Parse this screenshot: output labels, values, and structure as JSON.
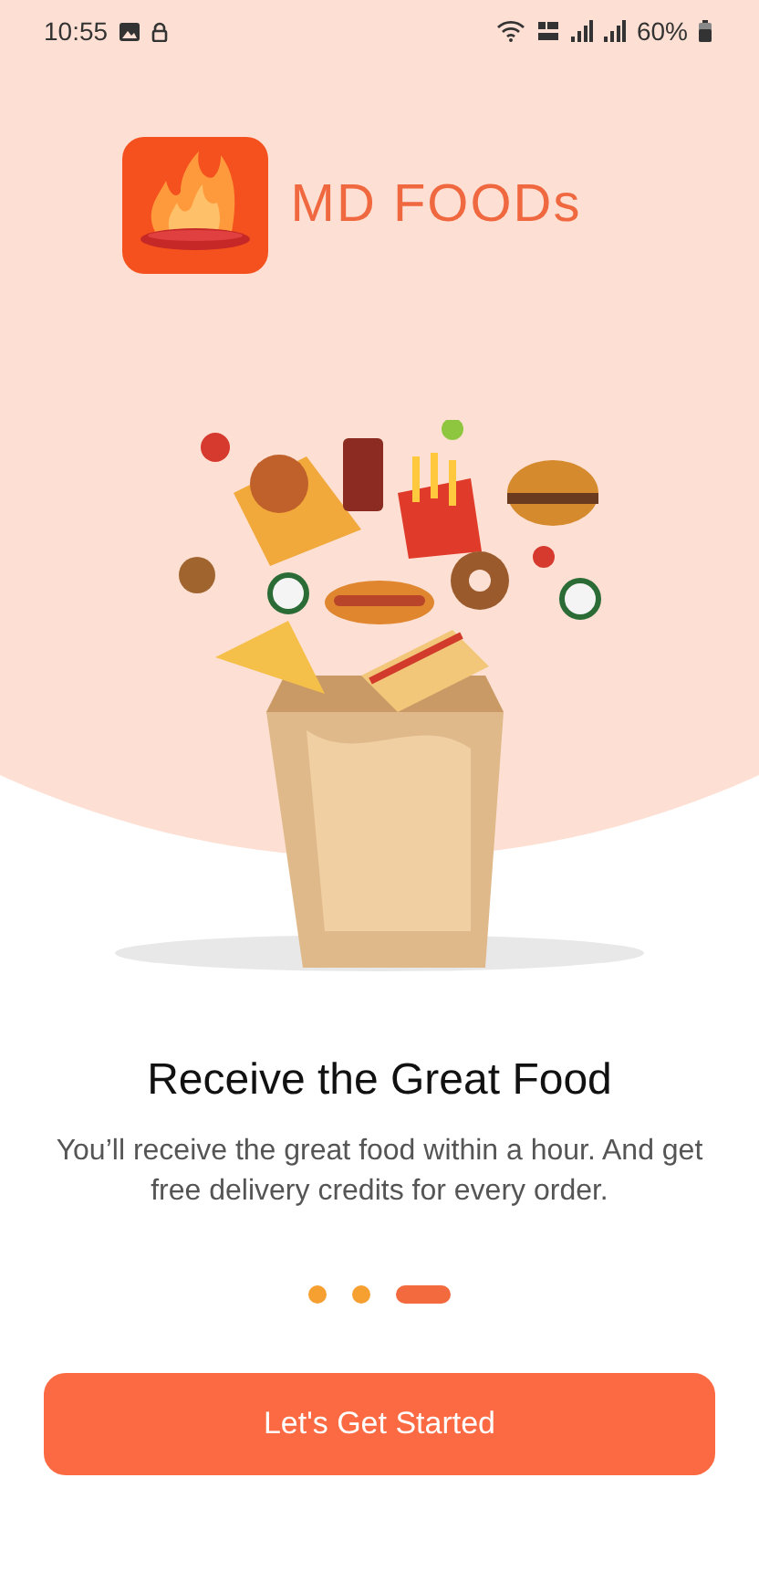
{
  "status_bar": {
    "time": "10:55",
    "battery": "60%"
  },
  "brand": {
    "name": "MD FOODs"
  },
  "slide": {
    "title": "Receive the Great Food",
    "description": "You’ll receive the great food within a hour. And get free delivery credits for every order."
  },
  "pager": [
    {
      "selected": false
    },
    {
      "selected": false
    },
    {
      "selected": true
    }
  ],
  "button": {
    "label": "Let's Get Started"
  }
}
